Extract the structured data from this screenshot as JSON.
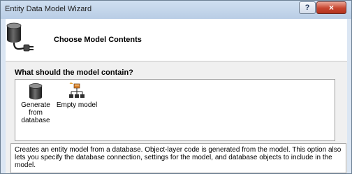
{
  "window": {
    "title": "Entity Data Model Wizard",
    "help_label": "?",
    "close_label": "×"
  },
  "header": {
    "title": "Choose Model Contents",
    "icon": "database-plug-icon"
  },
  "content": {
    "question": "What should the model contain?",
    "items": [
      {
        "line1": "Generate",
        "line2": "from",
        "line3": "database",
        "icon": "database-icon",
        "selected": false
      },
      {
        "line1": "Empty model",
        "icon": "entity-hierarchy-icon",
        "selected": false
      }
    ],
    "description": "Creates an entity model from a database. Object-layer code is generated from the model. This option also lets you specify the database connection, settings for the model, and database objects to include in the model."
  },
  "colors": {
    "titlebar": "#c3d5ea",
    "close_button": "#c7452f",
    "panel_background": "#f0f0f0"
  }
}
